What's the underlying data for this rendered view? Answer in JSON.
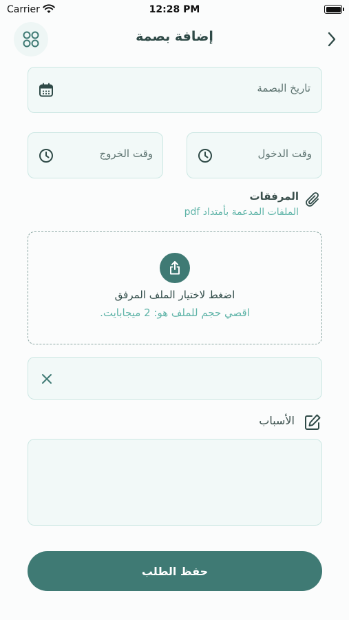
{
  "status_bar": {
    "carrier": "Carrier",
    "time": "12:28 PM"
  },
  "header": {
    "title": "إضافة بصمة",
    "menu_icon": "grid-icon",
    "back_icon": "chevron-right-icon"
  },
  "form": {
    "date_placeholder": "تاريخ البصمة",
    "checkin_placeholder": "وقت الدخول",
    "checkout_placeholder": "وقت الخروج",
    "attachments_title": "المرفقات",
    "attachments_hint": "الملفات المدعمة بأمتداد pdf",
    "upload_title": "اضغط لاختيار الملف المرفق",
    "upload_limit": "اقصي حجم للملف هو: 2 ميجابايت.",
    "reasons_label": "الأسباب",
    "reasons_value": "",
    "submit_label": "حفظ الطلب"
  },
  "colors": {
    "primary": "#3f7a74",
    "accent": "#5fb4a8",
    "field_bg": "#f2f9f8",
    "field_border": "#cce7e3"
  }
}
